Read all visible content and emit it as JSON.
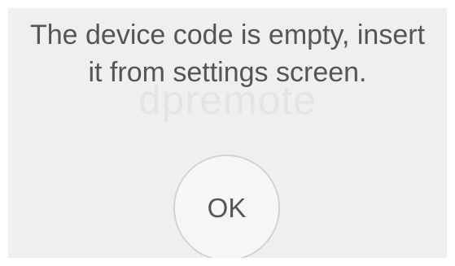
{
  "dialog": {
    "watermark": "dpremote",
    "message_line1": "The device code is empty, insert",
    "message_line2": "it from settings screen.",
    "ok_label": "OK"
  },
  "colors": {
    "dialog_background": "#efefef",
    "text": "#555555",
    "button_border": "#d3d3d3"
  }
}
